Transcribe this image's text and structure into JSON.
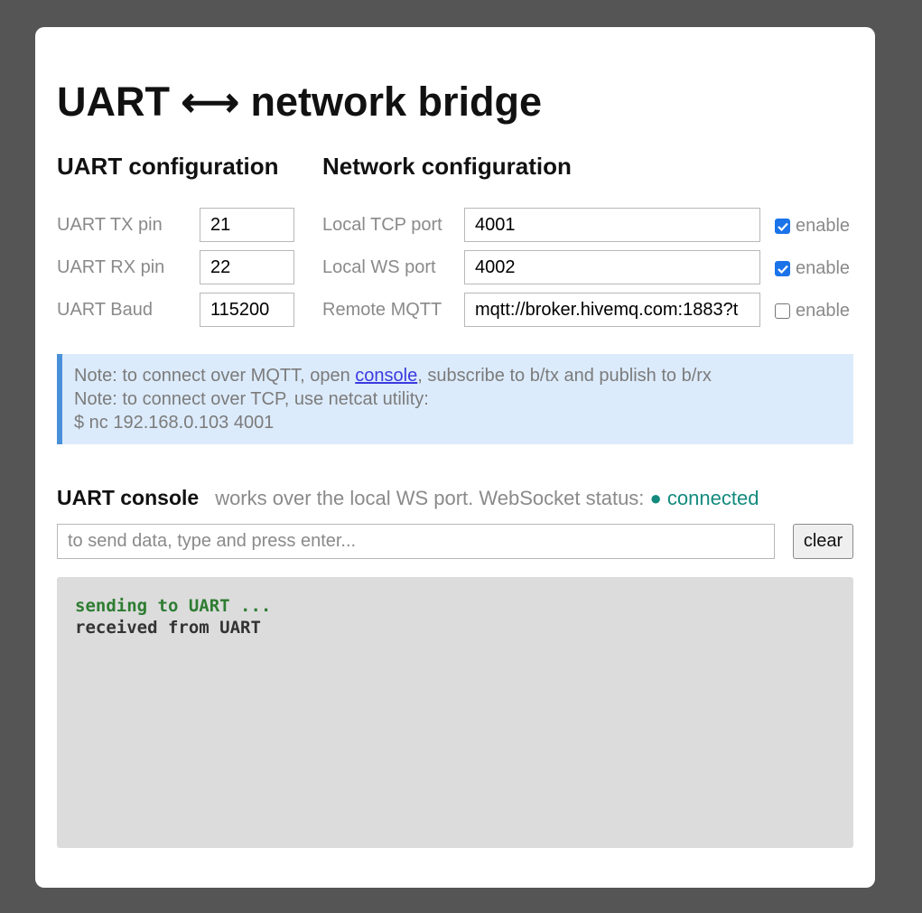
{
  "page": {
    "title": "UART ⟷ network bridge"
  },
  "uart": {
    "heading": "UART configuration",
    "tx_label": "UART TX pin",
    "tx_value": "21",
    "rx_label": "UART RX pin",
    "rx_value": "22",
    "baud_label": "UART Baud",
    "baud_value": "115200"
  },
  "network": {
    "heading": "Network configuration",
    "tcp_label": "Local TCP port",
    "tcp_value": "4001",
    "tcp_enabled": true,
    "ws_label": "Local WS port",
    "ws_value": "4002",
    "ws_enabled": true,
    "mqtt_label": "Remote MQTT",
    "mqtt_value": "mqtt://broker.hivemq.com:1883?t",
    "mqtt_enabled": false,
    "enable_label": "enable"
  },
  "note": {
    "line1_prefix": "Note: to connect over MQTT, open ",
    "line1_link": "console",
    "line1_suffix": ", subscribe to b/tx and publish to b/rx",
    "line2": "Note: to connect over TCP, use netcat utility:",
    "line3": "$ nc 192.168.0.103 4001"
  },
  "console": {
    "heading": "UART console",
    "subtitle": "works over the local WS port. WebSocket status: ",
    "status": "● connected",
    "input_placeholder": "to send data, type and press enter...",
    "clear_label": "clear",
    "lines": {
      "tx": "sending to UART ...",
      "rx": "received from UART"
    }
  },
  "colors": {
    "background": "#555555",
    "accent": "#1a73e8",
    "status_connected": "#138a7e",
    "note_border": "#4a90d9"
  }
}
